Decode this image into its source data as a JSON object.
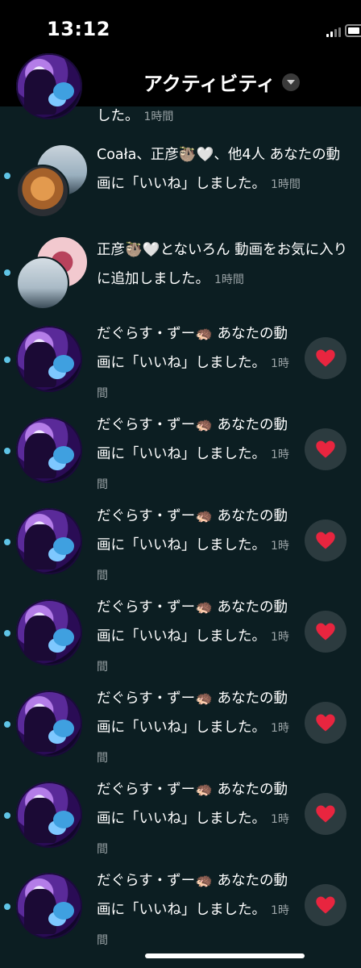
{
  "status_bar": {
    "time": "13:12"
  },
  "header": {
    "title": "アクティビティ"
  },
  "notifications": [
    {
      "text": "した。",
      "time": "1時間"
    },
    {
      "text": "Coała、正彦🦥🤍、他4人 あなたの動画に「いいね」しました。",
      "time": "1時間"
    },
    {
      "text": "正彦🦥🤍とないろん 動画をお気に入りに追加しました。",
      "time": "1時間"
    },
    {
      "text": "だぐらす・ずー🦔 あなたの動画に「いいね」しました。",
      "time": "1時間"
    },
    {
      "text": "だぐらす・ずー🦔 あなたの動画に「いいね」しました。",
      "time": "1時間"
    },
    {
      "text": "だぐらす・ずー🦔 あなたの動画に「いいね」しました。",
      "time": "1時間"
    },
    {
      "text": "だぐらす・ずー🦔 あなたの動画に「いいね」しました。",
      "time": "1時間"
    },
    {
      "text": "だぐらす・ずー🦔 あなたの動画に「いいね」しました。",
      "time": "1時間"
    },
    {
      "text": "だぐらす・ずー🦔 あなたの動画に「いいね」しました。",
      "time": "1時間"
    },
    {
      "text": "だぐらす・ずー🦔 あなたの動画に「いいね」しました。",
      "time": "1時間"
    }
  ],
  "colors": {
    "background": "#0c1e22",
    "unread_dot": "#5fc4e6",
    "heart": "#e8253f"
  },
  "icons": [
    "back-chevron-icon",
    "dropdown-caret-icon",
    "heart-icon",
    "signal-icon",
    "battery-icon"
  ]
}
